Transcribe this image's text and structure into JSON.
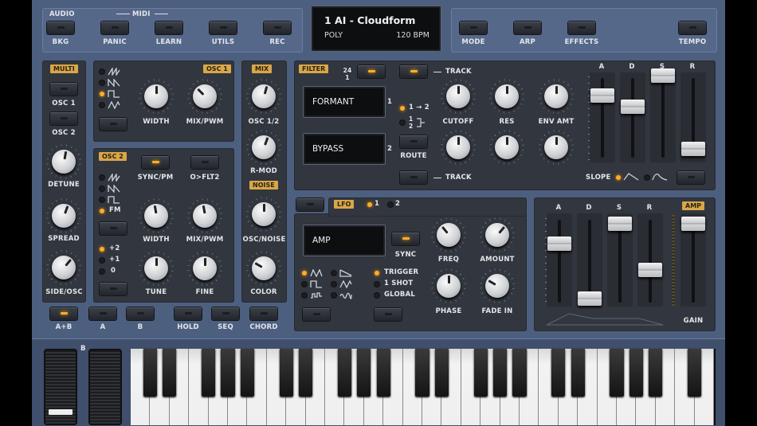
{
  "top": {
    "audio_label": "AUDIO",
    "midi_label": "MIDI",
    "buttons": [
      "BKG",
      "PANIC",
      "LEARN",
      "UTILS",
      "REC",
      "MODE",
      "ARP",
      "EFFECTS",
      "TEMPO"
    ]
  },
  "display": {
    "preset": "1 AI - Cloudform",
    "mode": "POLY",
    "bpm": "120 BPM"
  },
  "left": {
    "tag": "MULTI",
    "osc1": "OSC 1",
    "osc2": "OSC 2",
    "detune": "DETUNE",
    "spread": "SPREAD",
    "side": "SIDE/OSC"
  },
  "osc1": {
    "tag": "OSC 1",
    "width": "WIDTH",
    "mixpwm": "MIX/PWM"
  },
  "osc2": {
    "tag": "OSC 2",
    "sync": "SYNC/PM",
    "flt2": "O>FLT2",
    "fm": "FM",
    "width": "WIDTH",
    "mixpwm": "MIX/PWM",
    "tune": "TUNE",
    "fine": "FINE",
    "p2": "+2",
    "p1": "+1",
    "z": "0"
  },
  "mix": {
    "tag": "MIX",
    "osc12": "OSC 1/2",
    "rmod": "R-MOD",
    "noise_tag": "NOISE",
    "oscnoise": "OSC/NOISE",
    "color": "COLOR"
  },
  "filter": {
    "tag": "FILTER",
    "slope_top": "24",
    "slope_bot": "1",
    "track": "TRACK",
    "f1": "FORMANT",
    "f2": "BYPASS",
    "n1": "1",
    "n2": "2",
    "r12": "1 → 2",
    "r1": "1",
    "r2": "2",
    "route": "ROUTE",
    "cutoff": "CUTOFF",
    "res": "RES",
    "env": "ENV AMT",
    "track2": "TRACK"
  },
  "fenv": {
    "a": "A",
    "d": "D",
    "s": "S",
    "r": "R",
    "slope": "SLOPE"
  },
  "lfo": {
    "tag": "LFO",
    "n1": "1",
    "n2": "2",
    "dest": "AMP",
    "sync": "SYNC",
    "freq": "FREQ",
    "amount": "AMOUNT",
    "phase": "PHASE",
    "fade": "FADE IN",
    "trigger": "TRIGGER",
    "oneshot": "1 SHOT",
    "global": "GLOBAL"
  },
  "amp": {
    "a": "A",
    "d": "D",
    "s": "S",
    "r": "R",
    "tag": "AMP",
    "gain": "GAIN"
  },
  "bottom": {
    "buttons": [
      "A+B",
      "A",
      "B",
      "HOLD",
      "SEQ",
      "CHORD"
    ]
  },
  "keys": {
    "b_label": "B"
  },
  "colors": {
    "accent": "#d9a64a",
    "led": "#ffac2a",
    "panel": "#32363e",
    "frame": "#4d5f7f"
  }
}
